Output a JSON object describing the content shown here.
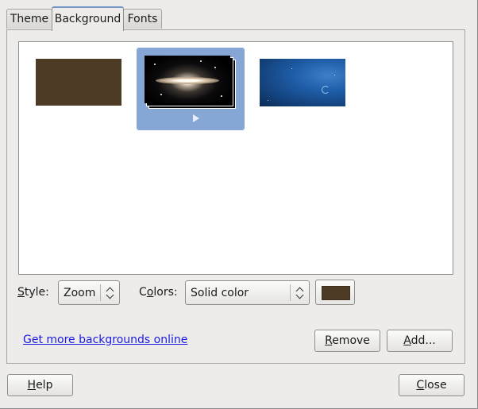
{
  "tabs": [
    {
      "label": "Theme",
      "active": false
    },
    {
      "label": "Background",
      "active": true
    },
    {
      "label": "Fonts",
      "active": false
    }
  ],
  "thumbnails": [
    {
      "name": "solid-color",
      "selected": false,
      "color": "#4d3b26"
    },
    {
      "name": "galaxy-slideshow",
      "selected": true
    },
    {
      "name": "blue-space",
      "selected": false
    }
  ],
  "style": {
    "label_pre": "",
    "label_mnemonic": "S",
    "label_post": "tyle:",
    "value": "Zoom"
  },
  "colors": {
    "label_pre": "C",
    "label_mnemonic": "o",
    "label_post": "lors:",
    "value": "Solid color",
    "swatch": "#4d3b26"
  },
  "link_text": "Get more backgrounds online",
  "buttons": {
    "remove": {
      "mnemonic": "R",
      "rest": "emove"
    },
    "add": {
      "mnemonic": "A",
      "rest": "dd..."
    },
    "help": {
      "mnemonic": "H",
      "rest": "elp"
    },
    "close": {
      "mnemonic": "C",
      "rest": "lose"
    }
  },
  "theme_colors": {
    "selection": "#86a6d6",
    "link": "#1a1ae0",
    "tab_accent": "#7394c6"
  }
}
